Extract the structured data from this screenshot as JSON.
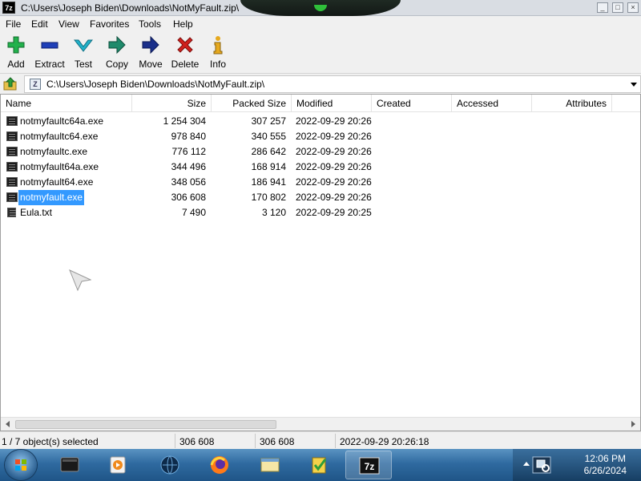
{
  "window": {
    "title": "C:\\Users\\Joseph Biden\\Downloads\\NotMyFault.zip\\",
    "app_icon_text": "7z",
    "buttons": [
      "_",
      "□",
      "×"
    ]
  },
  "menu": [
    "File",
    "Edit",
    "View",
    "Favorites",
    "Tools",
    "Help"
  ],
  "toolbar": [
    {
      "label": "Add",
      "icon": "plus-icon",
      "color": "#22b14c"
    },
    {
      "label": "Extract",
      "icon": "minus-icon",
      "color": "#1f3fb8"
    },
    {
      "label": "Test",
      "icon": "check-icon",
      "color": "#21b0c8"
    },
    {
      "label": "Copy",
      "icon": "arrow-right-icon",
      "color": "#1f8a6b"
    },
    {
      "label": "Move",
      "icon": "arrow-right-icon",
      "color": "#1a2f8a"
    },
    {
      "label": "Delete",
      "icon": "x-icon",
      "color": "#d0201d"
    },
    {
      "label": "Info",
      "icon": "info-icon",
      "color": "#e6a91e"
    }
  ],
  "address": {
    "path": "C:\\Users\\Joseph Biden\\Downloads\\NotMyFault.zip\\"
  },
  "columns": [
    "Name",
    "Size",
    "Packed Size",
    "Modified",
    "Created",
    "Accessed",
    "Attributes"
  ],
  "files": [
    {
      "name": "notmyfaultc64a.exe",
      "size": "1 254 304",
      "packed": "307 257",
      "modified": "2022-09-29 20:26",
      "type": "exe",
      "selected": false
    },
    {
      "name": "notmyfaultc64.exe",
      "size": "978 840",
      "packed": "340 555",
      "modified": "2022-09-29 20:26",
      "type": "exe",
      "selected": false
    },
    {
      "name": "notmyfaultc.exe",
      "size": "776 112",
      "packed": "286 642",
      "modified": "2022-09-29 20:26",
      "type": "exe",
      "selected": false
    },
    {
      "name": "notmyfault64a.exe",
      "size": "344 496",
      "packed": "168 914",
      "modified": "2022-09-29 20:26",
      "type": "exe",
      "selected": false
    },
    {
      "name": "notmyfault64.exe",
      "size": "348 056",
      "packed": "186 941",
      "modified": "2022-09-29 20:26",
      "type": "exe",
      "selected": false
    },
    {
      "name": "notmyfault.exe",
      "size": "306 608",
      "packed": "170 802",
      "modified": "2022-09-29 20:26",
      "type": "exe",
      "selected": true
    },
    {
      "name": "Eula.txt",
      "size": "7 490",
      "packed": "3 120",
      "modified": "2022-09-29 20:25",
      "type": "txt",
      "selected": false
    }
  ],
  "status": {
    "selection": "1 / 7 object(s) selected",
    "size": "306 608",
    "packed": "306 608",
    "modified": "2022-09-29 20:26:18"
  },
  "taskbar": {
    "clock_time": "12:06 PM",
    "clock_date": "6/26/2024",
    "apps": [
      "terminal-icon",
      "media-player-icon",
      "network-globe-icon",
      "firefox-icon",
      "explorer-window-icon",
      "notepad-check-icon",
      "7zip-icon"
    ]
  }
}
